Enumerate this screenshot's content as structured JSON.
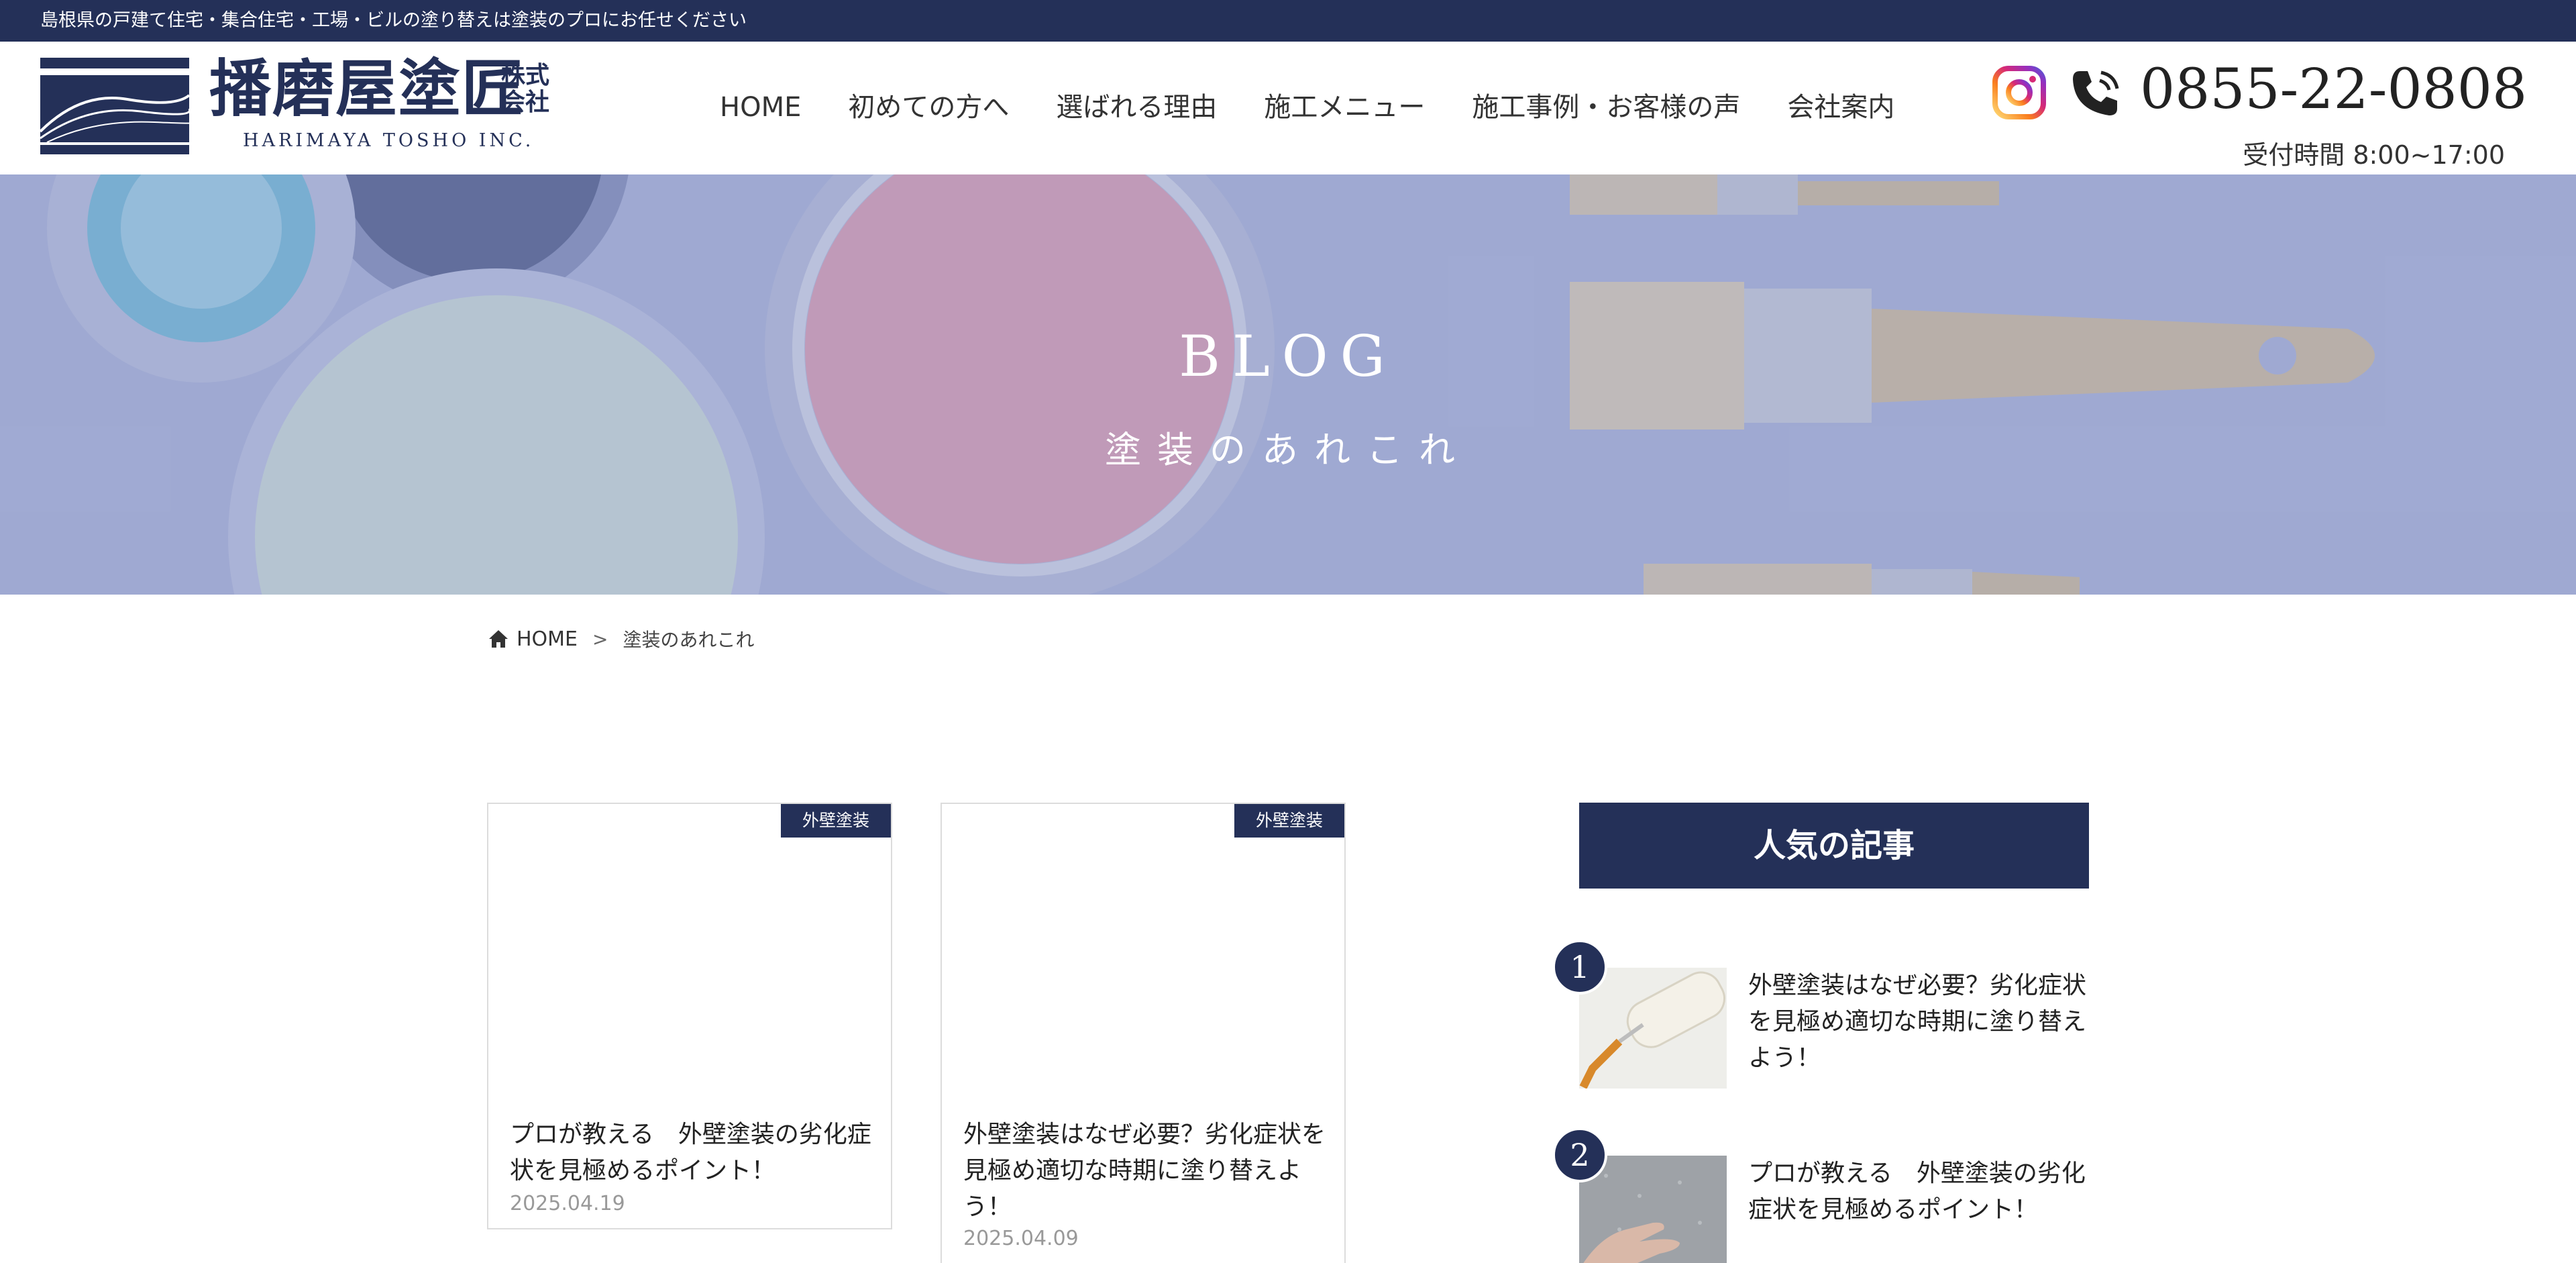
{
  "topbar": {
    "text": "島根県の戸建て住宅・集合住宅・工場・ビルの塗り替えは塗装のプロにお任せください"
  },
  "logo": {
    "name": "播磨屋塗匠",
    "corp": "株式会社",
    "en": "HARIMAYA TOSHO INC."
  },
  "nav": {
    "items": [
      "HOME",
      "初めての方へ",
      "選ばれる理由",
      "施工メニュー",
      "施工事例・お客様の声",
      "会社案内"
    ]
  },
  "contact": {
    "phone": "0855-22-0808",
    "hours": "受付時間 8:00~17:00"
  },
  "hero": {
    "title": "BLOG",
    "subtitle": "塗装のあれこれ"
  },
  "breadcrumb": {
    "home": "HOME",
    "separator": ">",
    "current": "塗装のあれこれ"
  },
  "cards": [
    {
      "tag": "外壁塗装",
      "title": "プロが教える　外壁塗装の劣化症状を見極めるポイント！",
      "date": "2025.04.19"
    },
    {
      "tag": "外壁塗装",
      "title": "外壁塗装はなぜ必要？劣化症状を見極め適切な時期に塗り替えよう！",
      "date": "2025.04.09"
    }
  ],
  "popular": {
    "heading": "人気の記事",
    "items": [
      {
        "rank": "1",
        "title": "外壁塗装はなぜ必要？劣化症状を見極め適切な時期に塗り替えよう！"
      },
      {
        "rank": "2",
        "title": "プロが教える　外壁塗装の劣化症状を見極めるポイント！"
      }
    ]
  },
  "colors": {
    "navy": "#243058",
    "white": "#ffffff",
    "date_gray": "#999999"
  },
  "icons": {
    "instagram": "instagram-icon",
    "phone": "phone-icon",
    "home": "home-icon"
  }
}
